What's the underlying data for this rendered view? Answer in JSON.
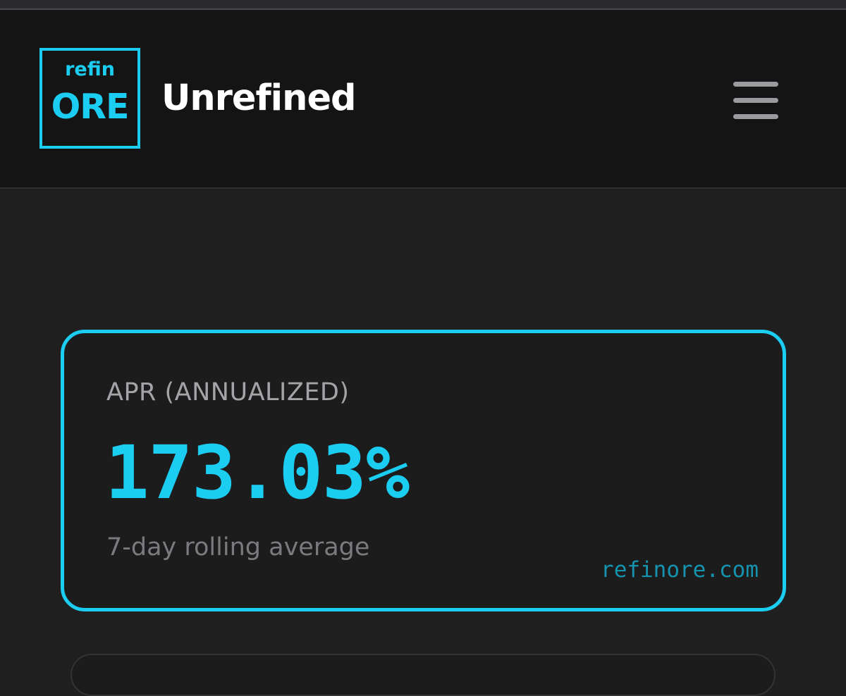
{
  "header": {
    "logo": {
      "top_text": "refin",
      "main_text": "ORE"
    },
    "title": "Unrefined",
    "menu_icon": "hamburger-menu-icon"
  },
  "apr_card": {
    "label": "APR (ANNUALIZED)",
    "value": "173.03%",
    "subtitle": "7-day rolling average",
    "site": "refinore.com"
  },
  "colors": {
    "accent": "#1ccdf2",
    "background": "#1f1f1f",
    "header_background": "#141414",
    "muted_text": "#a4a4a8"
  }
}
